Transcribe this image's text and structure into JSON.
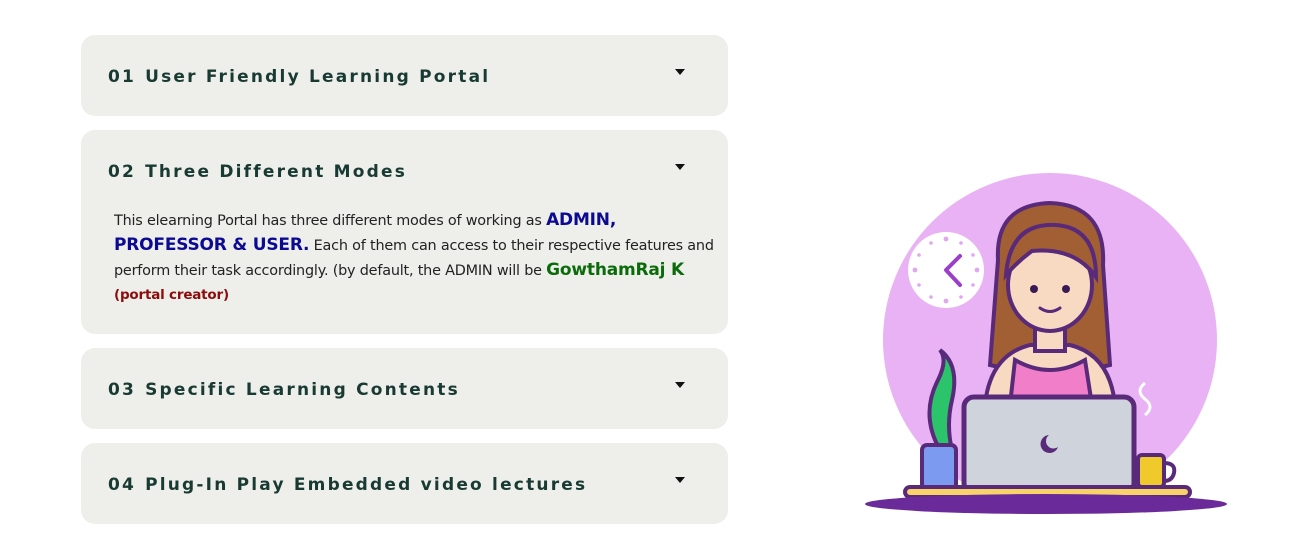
{
  "accordion": {
    "items": [
      {
        "number": "01",
        "title": "User Friendly Learning Portal",
        "expanded": false
      },
      {
        "number": "02",
        "title": "Three Different Modes",
        "expanded": true,
        "body": {
          "part1": "This elearning Portal has three different modes of working as ",
          "roles": "ADMIN, PROFESSOR & USER.",
          "part2": " Each of them can access to their respective features and perform their task accordingly. (by default, the ADMIN will be ",
          "admin_name": "GowthamRaj K",
          "admin_note": "(portal creator)"
        }
      },
      {
        "number": "03",
        "title": "Specific Learning Contents",
        "expanded": false
      },
      {
        "number": "04",
        "title": "Plug-In Play Embedded video lectures",
        "expanded": false
      }
    ]
  },
  "illustration": {
    "subject": "woman-working-on-laptop",
    "accent_color": "#e8b2f5"
  },
  "colors": {
    "panel_bg": "#eeefeb",
    "heading": "#193a33",
    "roles": "#0c0a92",
    "admin_name": "#0b6b0b",
    "admin_note": "#8c0c0c"
  }
}
